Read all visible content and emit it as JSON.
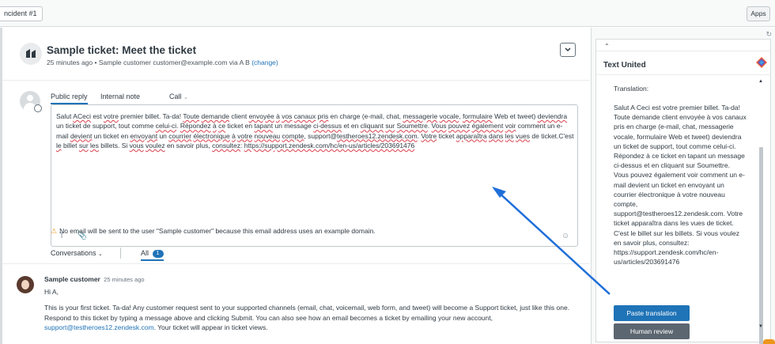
{
  "topbar": {
    "tab_label": "ncident #1",
    "apps_label": "Apps"
  },
  "ticket": {
    "title": "Sample ticket: Meet the ticket",
    "meta_prefix": "25 minutes ago • Sample customer   customer@example.com via A B",
    "change_link": "(change)"
  },
  "composer": {
    "tabs": {
      "public_reply": "Public reply",
      "internal_note": "Internal note",
      "call": "Call"
    },
    "tools": {
      "text_format": "T",
      "attach": "📎",
      "emoji": "☺"
    }
  },
  "warning": {
    "text": "No email will be sent to the user \"Sample customer\" because this email address uses an example domain."
  },
  "conversations": {
    "filter_label": "Conversations",
    "all_label": "All",
    "all_count": "1"
  },
  "message": {
    "author": "Sample customer",
    "time": "25 minutes ago",
    "greeting": "Hi A,",
    "body_main": "This is your first ticket. Ta-da! Any customer request sent to your supported channels (email, chat, voicemail, web form, and tweet) will become a Support ticket, just like this one. Respond to this ticket by typing a message above and clicking Submit. You can also see how an email becomes a ticket by emailing your new account,",
    "email_link": "support@testheroes12.zendesk.com",
    "body_end": ". Your ticket will appear in ticket views."
  },
  "sidebar": {
    "app_title": "Text United",
    "translation_label": "Translation:",
    "translation_text": "Salut A  Ceci est votre premier billet. Ta-da! Toute demande client envoyée à vos canaux pris en charge (e-mail, chat, messagerie vocale, formulaire Web et tweet) deviendra un ticket de support, tout comme celui-ci. Répondez à ce ticket en tapant un message ci-dessus et en cliquant sur Soumettre. Vous pouvez également voir comment un e-mail devient un ticket en envoyant un courrier électronique à votre nouveau compte, support@testheroes12.zendesk.com. Votre ticket apparaîtra dans les vues de ticket.  C'est le billet sur les billets. Si vous voulez en savoir plus, consultez: https://support.zendesk.com/hc/en-us/articles/203691476",
    "paste_button": "Paste translation",
    "human_button": "Human review"
  },
  "colors": {
    "accent": "#1f73b7",
    "arrow": "#1f6fd9",
    "warning": "#ed961c",
    "human_button": "#5c6670"
  }
}
